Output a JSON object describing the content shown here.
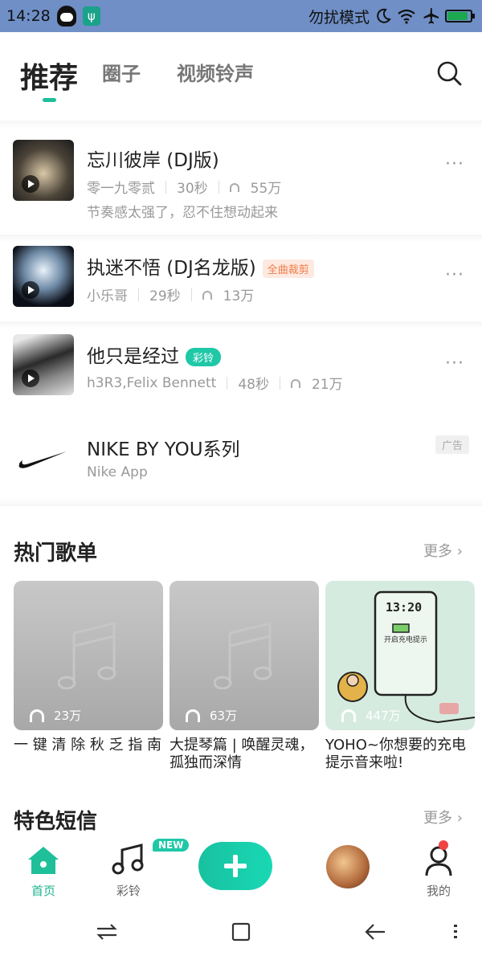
{
  "status_bar": {
    "time": "14:28",
    "right_text": "勿扰模式",
    "battery_level": 0.9
  },
  "header": {
    "tabs": [
      {
        "label": "推荐",
        "active": true
      },
      {
        "label": "圈子",
        "active": false
      },
      {
        "label": "视频铃声",
        "active": false
      }
    ]
  },
  "songs": [
    {
      "title": "忘川彼岸 (DJ版)",
      "artist": "零一九零贰",
      "duration": "30秒",
      "plays": "55万",
      "desc": "节奏感太强了，忍不住想动起来",
      "badge": ""
    },
    {
      "title": "执迷不悟 (DJ名龙版)",
      "artist": "小乐哥",
      "duration": "29秒",
      "plays": "13万",
      "desc": "",
      "badge": "全曲裁剪"
    },
    {
      "title": "他只是经过",
      "artist": "h3R3,Felix Bennett",
      "duration": "48秒",
      "plays": "21万",
      "desc": "",
      "badge": "彩铃"
    }
  ],
  "ad": {
    "title": "NIKE BY YOU系列",
    "subtitle": "Nike App",
    "tag": "广告"
  },
  "hot_playlists": {
    "title": "热门歌单",
    "more": "更多",
    "items": [
      {
        "plays": "23万",
        "title": "一 键 清 除 秋 乏 指 南"
      },
      {
        "plays": "63万",
        "title": "大提琴篇 | 唤醒灵魂，孤独而深情"
      },
      {
        "plays": "447万",
        "title": "YOHO~你想要的充电提示音来啦!"
      }
    ],
    "charger_screen_time": "13:20",
    "charger_screen_text": "开启充电提示"
  },
  "sms": {
    "title": "特色短信",
    "more": "更多"
  },
  "bottom_nav": {
    "items": [
      {
        "label": "首页",
        "active": true
      },
      {
        "label": "彩铃",
        "active": false
      },
      {
        "label": "我的",
        "active": false
      }
    ],
    "new_badge": "NEW"
  },
  "colors": {
    "accent": "#1fbf9a",
    "status_bar": "#6f8fc6"
  }
}
